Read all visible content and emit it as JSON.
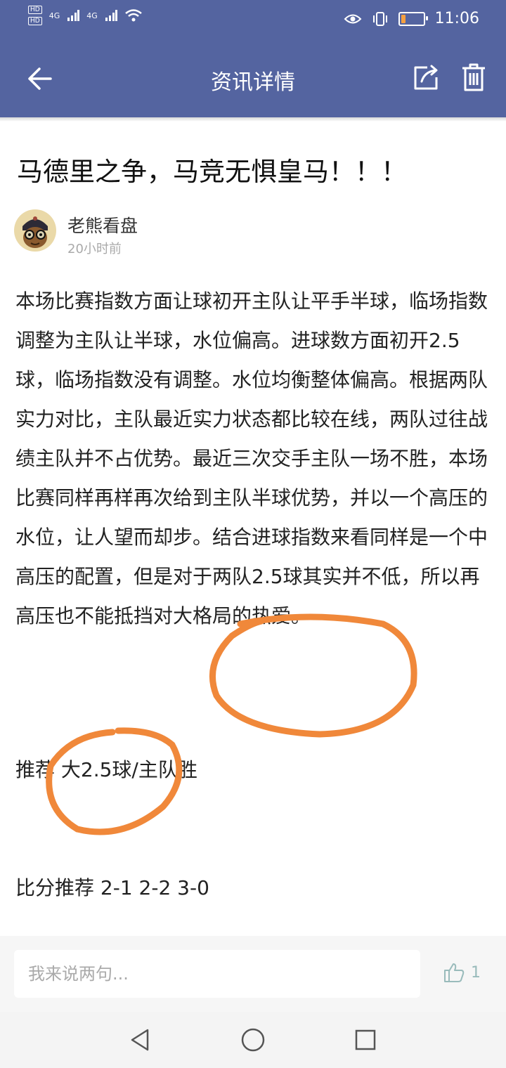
{
  "status_bar": {
    "hd_1": "HD",
    "hd_2": "HD",
    "signal_1": "4G",
    "signal_2": "4G",
    "time": "11:06",
    "battery_level": 0.18,
    "icons": [
      "eye-comfort-icon",
      "vibrate-icon",
      "battery-icon",
      "wifi-icon",
      "signal-icon"
    ]
  },
  "toolbar": {
    "title": "资讯详情",
    "back_icon": "back-arrow-icon",
    "share_icon": "share-icon",
    "delete_icon": "trash-icon"
  },
  "article": {
    "title": "马德里之争，马竞无惧皇马！！！",
    "author": "老熊看盘",
    "time": "20小时前",
    "body": "本场比赛指数方面让球初开主队让平手半球，临场指数调整为主队让半球，水位偏高。进球数方面初开2.5球，临场指数没有调整。水位均衡整体偏高。根据两队实力对比，主队最近实力状态都比较在线，两队过往战绩主队并不占优势。最近三次交手主队一场不胜，本场比赛同样再样再次给到主队半球优势，并以一个高压的水位，让人望而却步。结合进球指数来看同样是一个中高压的配置，但是对于两队2.5球其实并不低，所以再高压也不能抵挡对大格局的热爱。",
    "recommend": "推荐 大2.5球/主队胜",
    "score_recommend": "比分推荐 2-1 2-2 3-0"
  },
  "annotation_color": "#f0883a",
  "comment_bar": {
    "placeholder": "我来说两句...",
    "like_count": "1"
  },
  "nav_bar": {
    "icons": [
      "back-triangle-icon",
      "home-circle-icon",
      "recents-square-icon"
    ]
  }
}
